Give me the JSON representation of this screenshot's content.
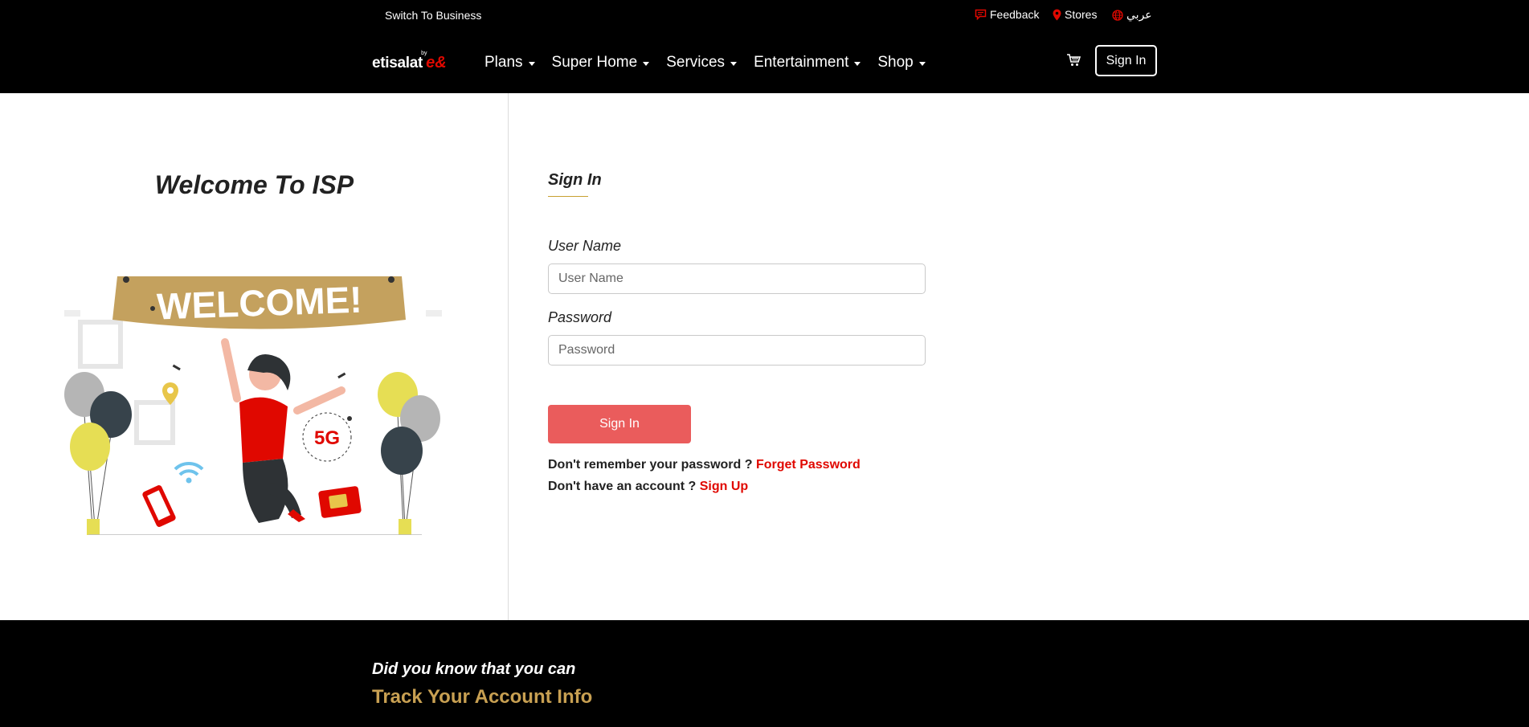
{
  "topbar": {
    "switch_label": "Switch To Business",
    "feedback_label": "Feedback",
    "stores_label": "Stores",
    "language_label": "عربي"
  },
  "nav": {
    "logo_text": "etisalat",
    "logo_mark": "e&",
    "logo_tm": "by",
    "items": [
      {
        "label": "Plans"
      },
      {
        "label": "Super Home"
      },
      {
        "label": "Services"
      },
      {
        "label": "Entertainment"
      },
      {
        "label": "Shop"
      }
    ],
    "signin_label": "Sign In"
  },
  "left": {
    "title": "Welcome To ISP",
    "banner_text": "WELCOME!",
    "badge_text": "5G"
  },
  "form": {
    "title": "Sign In",
    "username_label": "User Name",
    "username_placeholder": "User Name",
    "username_value": "",
    "password_label": "Password",
    "password_placeholder": "Password",
    "password_value": "",
    "submit_label": "Sign In",
    "forgot_prompt": "Don't remember your password ?",
    "forgot_link": "Forget Password",
    "signup_prompt": "Don't have an account ?",
    "signup_link": "Sign Up"
  },
  "footer": {
    "question": "Did you know that you can",
    "answer": "Track Your Account Info"
  },
  "colors": {
    "brand_red": "#e00800",
    "button_red": "#ea5c5c",
    "gold": "#c8a052",
    "dark": "#000000"
  }
}
